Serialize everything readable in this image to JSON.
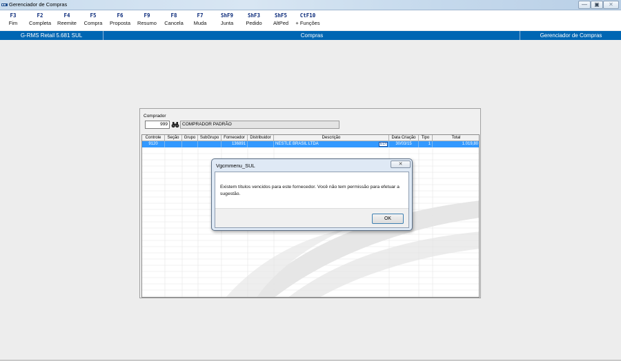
{
  "window": {
    "title": "Gerenciador de Compras",
    "controls": {
      "minimize": "—",
      "maximize": "▣",
      "close": "✕"
    }
  },
  "toolbar": {
    "keys": [
      {
        "key": "F3",
        "label": "Fim"
      },
      {
        "key": "F2",
        "label": "Completa"
      },
      {
        "key": "F4",
        "label": "Reemite"
      },
      {
        "key": "F5",
        "label": "Compra"
      },
      {
        "key": "F6",
        "label": "Proposta"
      },
      {
        "key": "F9",
        "label": "Resumo"
      },
      {
        "key": "F8",
        "label": "Cancela"
      },
      {
        "key": "F7",
        "label": "Muda"
      },
      {
        "key": "ShF9",
        "label": "Junta"
      },
      {
        "key": "ShF3",
        "label": "Pedido"
      },
      {
        "key": "ShF5",
        "label": "AltPed"
      },
      {
        "key": "CtF10",
        "label": "+ Funções"
      }
    ]
  },
  "statusbar": {
    "version": "G-RMS Retail 5.681 SUL",
    "module": "Compras",
    "screen": "Gerenciador de Compras"
  },
  "comprador": {
    "label": "Comprador",
    "code": "999",
    "name": "COMPRADOR PADRÃO",
    "search_icon": "binoculars-icon"
  },
  "grid": {
    "columns": [
      "Controle",
      "Seção",
      "Grupo",
      "SubGrupo",
      "Fornecedor",
      "Distribuidor",
      "Descrição",
      "Data Criação",
      "Tipo",
      "Total"
    ],
    "rows": [
      {
        "controle": "9120",
        "secao": "",
        "grupo": "",
        "subgrupo": "",
        "fornecedor": "136891",
        "distribuidor": "",
        "descricao": "NESTLE BRASIL LTDA",
        "badge": "EDI",
        "data_criacao": "30/03/15",
        "tipo": "1",
        "total": "1.019,80"
      }
    ],
    "selected_color": "#3399ff"
  },
  "dialog": {
    "title": "Vgcmmenu_SUL",
    "close_label": "✕",
    "message": "Existem títulos vencidos para este fornecedor. Você não tem permissão para efetuar a sugestão.",
    "ok_label": "OK"
  },
  "colors": {
    "status_blue": "#0066b3",
    "key_blue": "#0a2a7a",
    "selection": "#3399ff"
  }
}
